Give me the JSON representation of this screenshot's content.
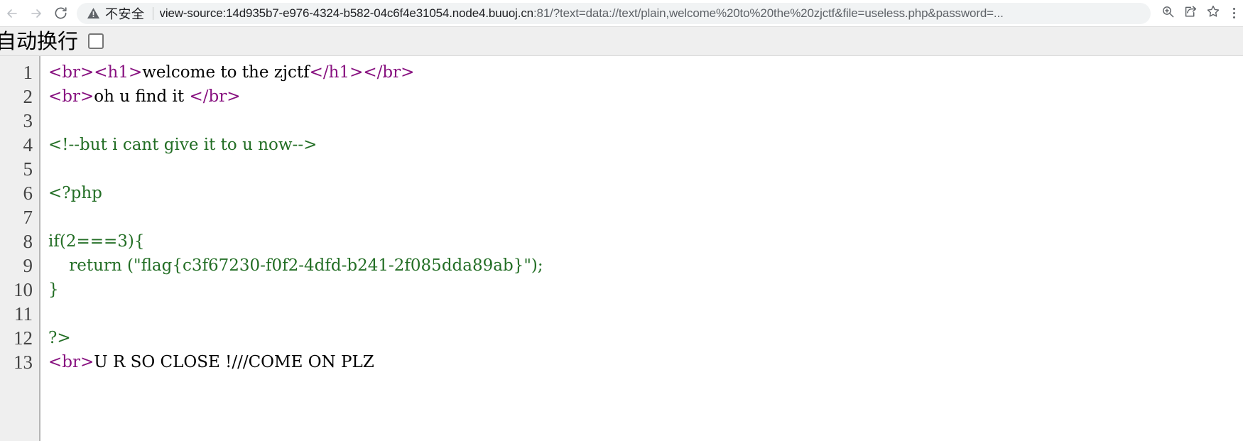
{
  "browser": {
    "back_icon": "back-arrow-icon",
    "forward_icon": "forward-arrow-icon",
    "reload_icon": "reload-icon",
    "security_icon": "warning-triangle-icon",
    "security_label": "不安全",
    "url_prefix": "view-source:",
    "url_host": "14d935b7-e976-4324-b582-04c6f4e31054.node4.buuoj.cn",
    "url_port": ":81",
    "url_path": "/?text=data://text/plain,welcome%20to%20the%20zjctf&file=useless.php&password=...",
    "url_full": "view-source:14d935b7-e976-4324-b582-04c6f4e31054.node4.buuoj.cn:81/?text=data://text/plain,welcome%20to%20the%20zjctf&file=useless.php&password=...",
    "zoom_icon": "zoom-in-magnifier-icon",
    "share_icon": "share-icon",
    "bookmark_icon": "bookmark-star-icon",
    "menu_icon": "three-dot-menu-icon"
  },
  "wrap_bar": {
    "label": "自动换行",
    "checked": false
  },
  "source": {
    "line_numbers": [
      "1",
      "2",
      "3",
      "4",
      "5",
      "6",
      "7",
      "8",
      "9",
      "10",
      "11",
      "12",
      "13"
    ],
    "lines": [
      {
        "n": "1",
        "segments": [
          {
            "t": "tag",
            "v": "<br><h1>"
          },
          {
            "t": "txt",
            "v": "welcome to the zjctf"
          },
          {
            "t": "tag",
            "v": "</h1></br>"
          }
        ]
      },
      {
        "n": "2",
        "segments": [
          {
            "t": "tag",
            "v": "<br>"
          },
          {
            "t": "txt",
            "v": "oh u find it "
          },
          {
            "t": "tag",
            "v": "</br>"
          }
        ]
      },
      {
        "n": "3",
        "segments": [
          {
            "t": "txt",
            "v": ""
          }
        ]
      },
      {
        "n": "4",
        "segments": [
          {
            "t": "cmt",
            "v": "<!--but i cant give it to u now-->"
          }
        ]
      },
      {
        "n": "5",
        "segments": [
          {
            "t": "txt",
            "v": ""
          }
        ]
      },
      {
        "n": "6",
        "segments": [
          {
            "t": "php",
            "v": "<?php"
          }
        ]
      },
      {
        "n": "7",
        "segments": [
          {
            "t": "txt",
            "v": ""
          }
        ]
      },
      {
        "n": "8",
        "segments": [
          {
            "t": "php",
            "v": "if(2===3){"
          }
        ]
      },
      {
        "n": "9",
        "segments": [
          {
            "t": "php",
            "v": "    return (\"flag{c3f67230-f0f2-4dfd-b241-2f085dda89ab}\");"
          }
        ]
      },
      {
        "n": "10",
        "segments": [
          {
            "t": "php",
            "v": "}"
          }
        ]
      },
      {
        "n": "11",
        "segments": [
          {
            "t": "txt",
            "v": ""
          }
        ]
      },
      {
        "n": "12",
        "segments": [
          {
            "t": "php",
            "v": "?>"
          }
        ]
      },
      {
        "n": "13",
        "segments": [
          {
            "t": "tag",
            "v": "<br>"
          },
          {
            "t": "txt",
            "v": "U R SO CLOSE !///COME ON PLZ"
          }
        ]
      }
    ],
    "flag": "flag{c3f67230-f0f2-4dfd-b241-2f085dda89ab}"
  },
  "colors": {
    "tag": "#881280",
    "comment": "#236e25",
    "text": "#000000",
    "gutter_bg": "#efefef",
    "omnibox_bg": "#f1f3f4"
  }
}
